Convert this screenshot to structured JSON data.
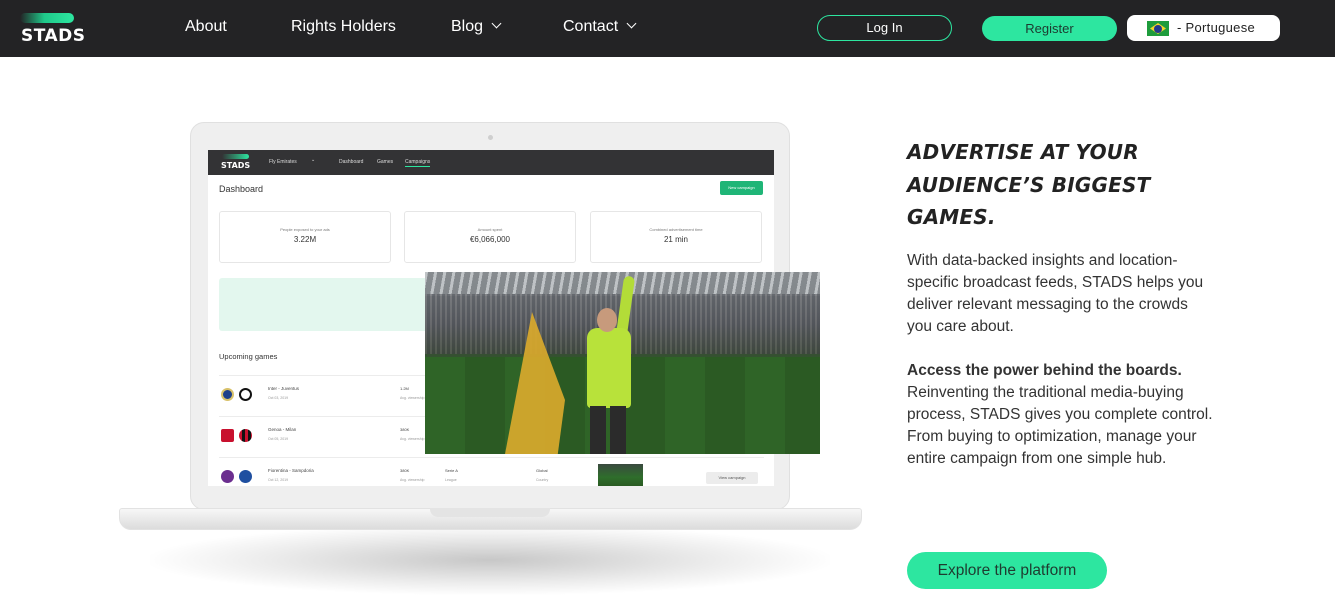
{
  "nav": {
    "logo_text": "STADS",
    "links": {
      "about": "About",
      "rights_holders": "Rights Holders",
      "blog": "Blog",
      "contact": "Contact"
    },
    "login_label": "Log In",
    "register_label": "Register",
    "language_label": "- Portuguese"
  },
  "dashboard_mockup": {
    "logo_text": "STADS",
    "account": "Fly Emirates",
    "tabs": [
      "Dashboard",
      "Games",
      "Campaigns"
    ],
    "title": "Dashboard",
    "new_button": "New campaign",
    "stats": [
      {
        "label": "People exposed to your ads",
        "value": "3.22M"
      },
      {
        "label": "Amount spent",
        "value": "€6,066,000"
      },
      {
        "label": "Combined advertisement time",
        "value": "21 min"
      }
    ],
    "upcoming_title": "Upcoming games",
    "games": [
      {
        "match": "Inter - Juventus",
        "date": "Oct 03, 2019",
        "audience": "1.2M",
        "audience_sub": "Avg. viewership",
        "league": "",
        "region": "",
        "action": ""
      },
      {
        "match": "Genoa - Milan",
        "date": "Oct 05, 2019",
        "audience": "380K",
        "audience_sub": "Avg. viewership",
        "league": "",
        "region": "",
        "action": ""
      },
      {
        "match": "Fiorentina - Sampdoria",
        "date": "Oct 12, 2019",
        "audience": "380K",
        "audience_sub": "Avg. viewership",
        "league": "Serie A",
        "league_sub": "League",
        "region": "Global",
        "region_sub": "Country",
        "action": "View campaign"
      }
    ]
  },
  "hero": {
    "heading": "ADVERTISE AT YOUR AUDIENCE’S BIGGEST GAMES.",
    "paragraph1": "With data-backed insights and location-specific broadcast feeds, STADS helps you deliver relevant messaging to the crowds you care about.",
    "paragraph2_bold": "Access the power behind the boards.",
    "paragraph2": "Reinventing the traditional media-buying process, STADS gives you complete control. From buying to optimization, manage your entire campaign from one simple hub.",
    "cta_label": "Explore the platform"
  },
  "colors": {
    "nav_bg": "#232325",
    "accent": "#2de6a0",
    "text": "#333333"
  }
}
